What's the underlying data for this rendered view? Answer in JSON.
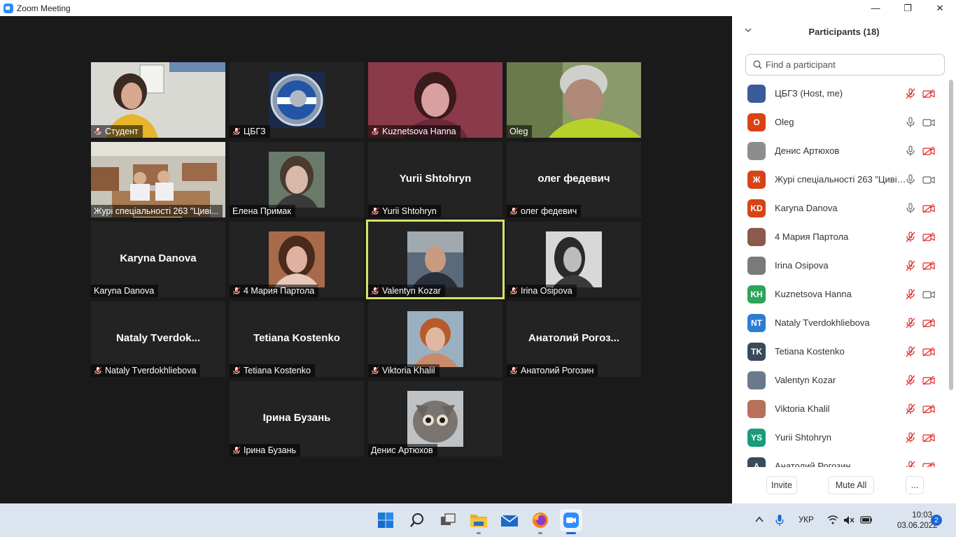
{
  "window": {
    "title": "Zoom Meeting",
    "minimize": "—",
    "restore": "❐",
    "close": "✕"
  },
  "tiles": [
    {
      "label": "Студент",
      "muted": true
    },
    {
      "label": "ЦБГЗ",
      "muted": true
    },
    {
      "label": "Kuznetsova Hanna",
      "muted": true
    },
    {
      "label": "Oleg",
      "muted": false
    },
    {
      "label": "Журі спеціальності 263 \"Циві...",
      "muted": false
    },
    {
      "label": "Елена Примак",
      "muted": false
    },
    {
      "label": "Yurii Shtohryn",
      "center": "Yurii Shtohryn",
      "muted": true
    },
    {
      "label": "олег федевич",
      "center": "олег федевич",
      "muted": true
    },
    {
      "label": "Karyna Danova",
      "center": "Karyna Danova",
      "muted": false
    },
    {
      "label": "4 Мария Партола",
      "muted": true
    },
    {
      "label": "Valentyn Kozar",
      "muted": true,
      "active": true
    },
    {
      "label": "Irina Osipova",
      "muted": true
    },
    {
      "label": "Nataly Tverdokhliebova",
      "center": "Nataly  Tverdok...",
      "muted": true
    },
    {
      "label": "Tetiana Kostenko",
      "center": "Tetiana Kostenko",
      "muted": true
    },
    {
      "label": "Viktoria Khalil",
      "muted": true
    },
    {
      "label": "Анатолий Рогозин",
      "center": "Анатолий  Рогоз...",
      "muted": true
    },
    {
      "label": "Ірина Бузань",
      "center": "Ірина Бузань",
      "muted": true
    },
    {
      "label": "Денис Артюхов",
      "muted": false
    }
  ],
  "panel": {
    "title": "Participants (18)",
    "search_placeholder": "Find a participant",
    "participants": [
      {
        "name": "ЦБГЗ (Host, me)",
        "avatar": "",
        "color": "#3a5a9a",
        "mic": "muted",
        "video": "off"
      },
      {
        "name": "Oleg",
        "avatar": "O",
        "color": "#d84315",
        "mic": "on",
        "video": "on"
      },
      {
        "name": "Денис Артюхов",
        "avatar": "",
        "color": "#8d8d8d",
        "mic": "on",
        "video": "off"
      },
      {
        "name": "Журі спеціальності 263 \"Цивіл...",
        "avatar": "Ж",
        "color": "#d84315",
        "mic": "on",
        "video": "on"
      },
      {
        "name": "Karyna Danova",
        "avatar": "KD",
        "color": "#d84315",
        "mic": "on",
        "video": "off"
      },
      {
        "name": "4 Мария Партола",
        "avatar": "",
        "color": "#8a5a4a",
        "mic": "muted",
        "video": "off"
      },
      {
        "name": "Irina Osipova",
        "avatar": "",
        "color": "#7a7a7a",
        "mic": "muted",
        "video": "off"
      },
      {
        "name": "Kuznetsova Hanna",
        "avatar": "KH",
        "color": "#2ea35a",
        "mic": "muted",
        "video": "on"
      },
      {
        "name": "Nataly Tverdokhliebova",
        "avatar": "NT",
        "color": "#2d7dd2",
        "mic": "muted",
        "video": "off"
      },
      {
        "name": "Tetiana Kostenko",
        "avatar": "TK",
        "color": "#3a4a5a",
        "mic": "muted",
        "video": "off"
      },
      {
        "name": "Valentyn Kozar",
        "avatar": "",
        "color": "#6a7a8a",
        "mic": "muted",
        "video": "off"
      },
      {
        "name": "Viktoria Khalil",
        "avatar": "",
        "color": "#b8705a",
        "mic": "muted",
        "video": "off"
      },
      {
        "name": "Yurii Shtohryn",
        "avatar": "YS",
        "color": "#1a9a7a",
        "mic": "muted",
        "video": "off"
      },
      {
        "name": "Анатолий Рогозин",
        "avatar": "А",
        "color": "#3a4a5a",
        "mic": "muted",
        "video": "off"
      }
    ],
    "invite": "Invite",
    "mute_all": "Mute All",
    "more": "..."
  },
  "taskbar": {
    "lang": "УКР",
    "time": "10:03",
    "date": "03.06.2022",
    "notifications": "2"
  }
}
